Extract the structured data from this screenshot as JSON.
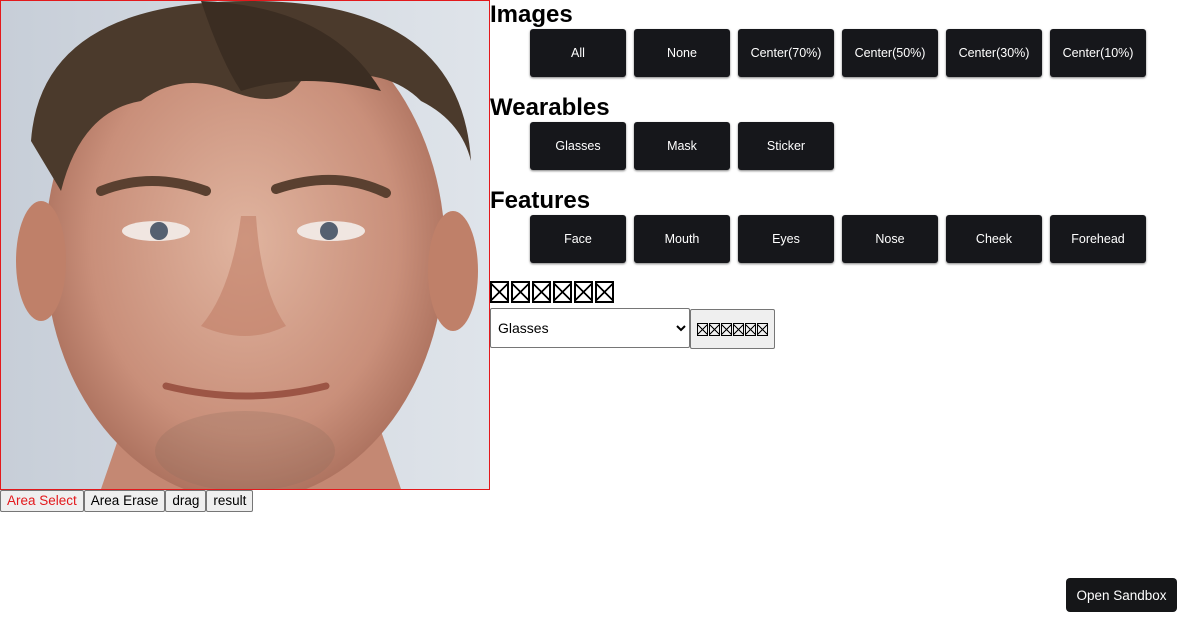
{
  "photo": {
    "alt": "face photo"
  },
  "tools": [
    {
      "label": "Area Select",
      "active": true
    },
    {
      "label": "Area Erase",
      "active": false
    },
    {
      "label": "drag",
      "active": false
    },
    {
      "label": "result",
      "active": false
    }
  ],
  "sections": {
    "images": {
      "title": "Images",
      "buttons": [
        "All",
        "None",
        "Center(70%)",
        "Center(50%)",
        "Center(30%)",
        "Center(10%)"
      ]
    },
    "wearables": {
      "title": "Wearables",
      "buttons": [
        "Glasses",
        "Mask",
        "Sticker"
      ]
    },
    "features": {
      "title": "Features",
      "buttons": [
        "Face",
        "Mouth",
        "Eyes",
        "Nose",
        "Cheek",
        "Forehead"
      ]
    }
  },
  "wearable_picker": {
    "selected": "Glasses",
    "options": [
      "Glasses"
    ]
  },
  "footer": {
    "sandbox_label": "Open Sandbox"
  },
  "colors": {
    "accent_red": "#e3191c",
    "dark_button": "#16171b"
  }
}
